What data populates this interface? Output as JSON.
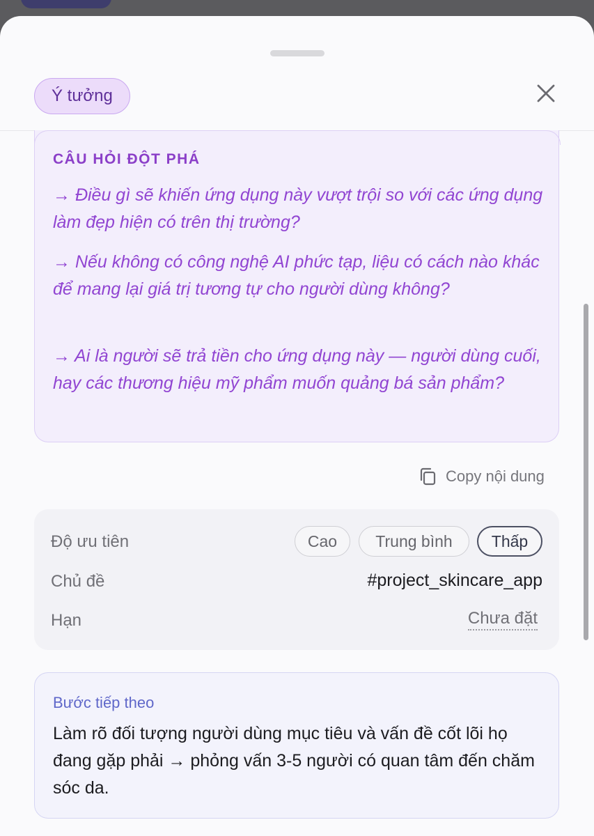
{
  "header": {
    "category_tag": "Ý tưởng",
    "close_icon": "close-icon"
  },
  "questions": {
    "heading": "CÂU HỎI ĐỘT PHÁ",
    "items": [
      "→ Điều gì sẽ khiến ứng dụng này vượt trội so với các ứng dụng làm đẹp hiện có trên thị trường?",
      "→ Nếu không có công nghệ AI phức tạp, liệu có cách nào khác để mang lại giá trị tương tự cho người dùng không?",
      "→ Ai là người sẽ trả tiền cho ứng dụng này — người dùng cuối, hay các thương hiệu mỹ phẩm muốn quảng bá sản phẩm?"
    ]
  },
  "copy": {
    "label": "Copy nội dung",
    "icon": "copy-icon"
  },
  "meta": {
    "priority_label": "Độ ưu tiên",
    "priority_options": [
      "Cao",
      "Trung bình",
      "Thấp"
    ],
    "priority_selected": "Thấp",
    "topic_label": "Chủ đề",
    "topic_value": "#project_skincare_app",
    "deadline_label": "Hạn",
    "deadline_value": "Chưa đặt"
  },
  "next_step": {
    "heading": "Bước tiếp theo",
    "body": "Làm rõ đối tượng người dùng mục tiêu và vấn đề cốt lõi họ đang gặp phải → phỏng vấn 3-5 người có quan tâm đến chăm sóc da."
  },
  "colors": {
    "accent_purple": "#9145d2",
    "tag_bg": "#ecdcfa",
    "next_heading": "#5f67c9"
  }
}
